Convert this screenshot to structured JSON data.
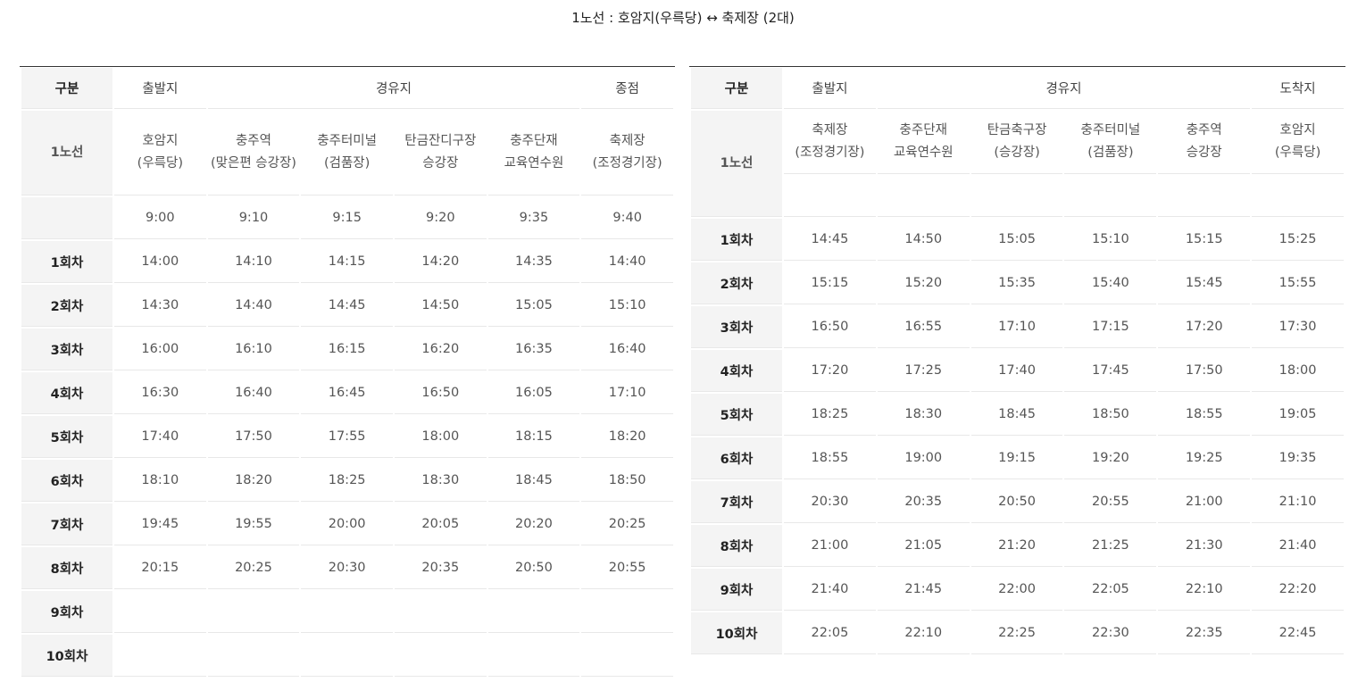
{
  "title": "1노선 : 호암지(우륵당) ↔ 축제장 (2대)",
  "left": {
    "header": {
      "col0": "구분",
      "departure": "출발지",
      "via": "경유지",
      "end": "종점"
    },
    "route_label": "1노선",
    "stops": [
      "호암지\n(우륵당)",
      "충주역\n(맞은편 승강장)",
      "충주터미널\n(검품장)",
      "탄금잔디구장\n승강장",
      "충주단재\n교육연수원",
      "축제장\n(조정경기장)"
    ],
    "rows": [
      {
        "label": "",
        "times": [
          "9:00",
          "9:10",
          "9:15",
          "9:20",
          "9:35",
          "9:40"
        ]
      },
      {
        "label": "1회차",
        "times": [
          "14:00",
          "14:10",
          "14:15",
          "14:20",
          "14:35",
          "14:40"
        ]
      },
      {
        "label": "2회차",
        "times": [
          "14:30",
          "14:40",
          "14:45",
          "14:50",
          "15:05",
          "15:10"
        ]
      },
      {
        "label": "3회차",
        "times": [
          "16:00",
          "16:10",
          "16:15",
          "16:20",
          "16:35",
          "16:40"
        ]
      },
      {
        "label": "4회차",
        "times": [
          "16:30",
          "16:40",
          "16:45",
          "16:50",
          "16:05",
          "17:10"
        ]
      },
      {
        "label": "5회차",
        "times": [
          "17:40",
          "17:50",
          "17:55",
          "18:00",
          "18:15",
          "18:20"
        ]
      },
      {
        "label": "6회차",
        "times": [
          "18:10",
          "18:20",
          "18:25",
          "18:30",
          "18:45",
          "18:50"
        ]
      },
      {
        "label": "7회차",
        "times": [
          "19:45",
          "19:55",
          "20:00",
          "20:05",
          "20:20",
          "20:25"
        ]
      },
      {
        "label": "8회차",
        "times": [
          "20:15",
          "20:25",
          "20:30",
          "20:35",
          "20:50",
          "20:55"
        ]
      },
      {
        "label": "9회차",
        "times": [
          "",
          "",
          "",
          "",
          "",
          ""
        ]
      },
      {
        "label": "10회차",
        "times": [
          "",
          "",
          "",
          "",
          "",
          ""
        ]
      }
    ]
  },
  "right": {
    "header": {
      "col0": "구분",
      "departure": "출발지",
      "via": "경유지",
      "end": "도착지"
    },
    "route_label": "1노선",
    "stops": [
      "축제장\n(조정경기장)",
      "충주단재\n교육연수원",
      "탄금축구장\n(승강장)",
      "충주터미널\n(검품장)",
      "충주역\n승강장",
      "호암지\n(우륵당)"
    ],
    "rows": [
      {
        "label": "1회차",
        "times": [
          "14:45",
          "14:50",
          "15:05",
          "15:10",
          "15:15",
          "15:25"
        ]
      },
      {
        "label": "2회차",
        "times": [
          "15:15",
          "15:20",
          "15:35",
          "15:40",
          "15:45",
          "15:55"
        ]
      },
      {
        "label": "3회차",
        "times": [
          "16:50",
          "16:55",
          "17:10",
          "17:15",
          "17:20",
          "17:30"
        ]
      },
      {
        "label": "4회차",
        "times": [
          "17:20",
          "17:25",
          "17:40",
          "17:45",
          "17:50",
          "18:00"
        ]
      },
      {
        "label": "5회차",
        "times": [
          "18:25",
          "18:30",
          "18:45",
          "18:50",
          "18:55",
          "19:05"
        ]
      },
      {
        "label": "6회차",
        "times": [
          "18:55",
          "19:00",
          "19:15",
          "19:20",
          "19:25",
          "19:35"
        ]
      },
      {
        "label": "7회차",
        "times": [
          "20:30",
          "20:35",
          "20:50",
          "20:55",
          "21:00",
          "21:10"
        ]
      },
      {
        "label": "8회차",
        "times": [
          "21:00",
          "21:05",
          "21:20",
          "21:25",
          "21:30",
          "21:40"
        ]
      },
      {
        "label": "9회차",
        "times": [
          "21:40",
          "21:45",
          "22:00",
          "22:05",
          "22:10",
          "22:20"
        ]
      },
      {
        "label": "10회차",
        "times": [
          "22:05",
          "22:10",
          "22:25",
          "22:30",
          "22:35",
          "22:45"
        ]
      }
    ]
  }
}
